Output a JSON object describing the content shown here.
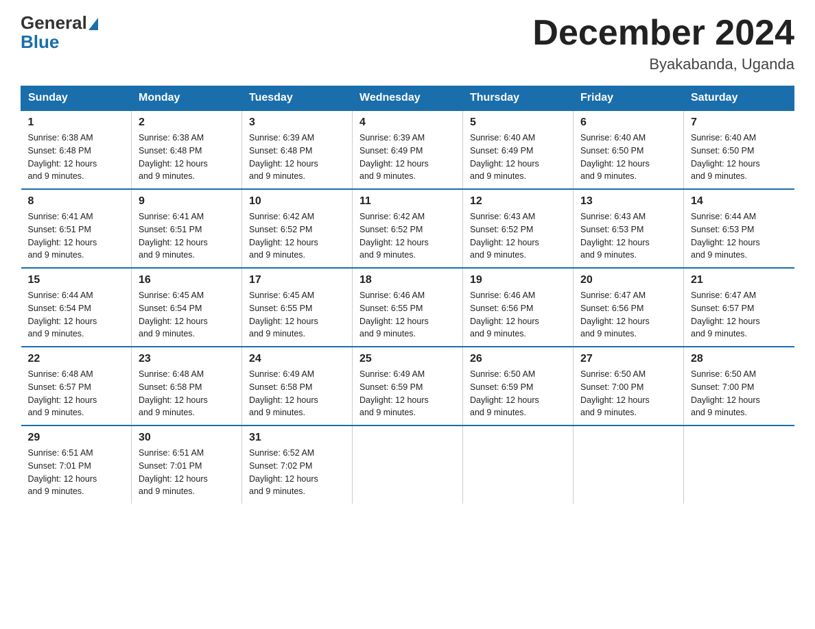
{
  "header": {
    "logo_general": "General",
    "logo_blue": "Blue",
    "month_title": "December 2024",
    "location": "Byakabanda, Uganda"
  },
  "days_of_week": [
    "Sunday",
    "Monday",
    "Tuesday",
    "Wednesday",
    "Thursday",
    "Friday",
    "Saturday"
  ],
  "weeks": [
    [
      {
        "day": "1",
        "sunrise": "6:38 AM",
        "sunset": "6:48 PM",
        "daylight": "12 hours and 9 minutes."
      },
      {
        "day": "2",
        "sunrise": "6:38 AM",
        "sunset": "6:48 PM",
        "daylight": "12 hours and 9 minutes."
      },
      {
        "day": "3",
        "sunrise": "6:39 AM",
        "sunset": "6:48 PM",
        "daylight": "12 hours and 9 minutes."
      },
      {
        "day": "4",
        "sunrise": "6:39 AM",
        "sunset": "6:49 PM",
        "daylight": "12 hours and 9 minutes."
      },
      {
        "day": "5",
        "sunrise": "6:40 AM",
        "sunset": "6:49 PM",
        "daylight": "12 hours and 9 minutes."
      },
      {
        "day": "6",
        "sunrise": "6:40 AM",
        "sunset": "6:50 PM",
        "daylight": "12 hours and 9 minutes."
      },
      {
        "day": "7",
        "sunrise": "6:40 AM",
        "sunset": "6:50 PM",
        "daylight": "12 hours and 9 minutes."
      }
    ],
    [
      {
        "day": "8",
        "sunrise": "6:41 AM",
        "sunset": "6:51 PM",
        "daylight": "12 hours and 9 minutes."
      },
      {
        "day": "9",
        "sunrise": "6:41 AM",
        "sunset": "6:51 PM",
        "daylight": "12 hours and 9 minutes."
      },
      {
        "day": "10",
        "sunrise": "6:42 AM",
        "sunset": "6:52 PM",
        "daylight": "12 hours and 9 minutes."
      },
      {
        "day": "11",
        "sunrise": "6:42 AM",
        "sunset": "6:52 PM",
        "daylight": "12 hours and 9 minutes."
      },
      {
        "day": "12",
        "sunrise": "6:43 AM",
        "sunset": "6:52 PM",
        "daylight": "12 hours and 9 minutes."
      },
      {
        "day": "13",
        "sunrise": "6:43 AM",
        "sunset": "6:53 PM",
        "daylight": "12 hours and 9 minutes."
      },
      {
        "day": "14",
        "sunrise": "6:44 AM",
        "sunset": "6:53 PM",
        "daylight": "12 hours and 9 minutes."
      }
    ],
    [
      {
        "day": "15",
        "sunrise": "6:44 AM",
        "sunset": "6:54 PM",
        "daylight": "12 hours and 9 minutes."
      },
      {
        "day": "16",
        "sunrise": "6:45 AM",
        "sunset": "6:54 PM",
        "daylight": "12 hours and 9 minutes."
      },
      {
        "day": "17",
        "sunrise": "6:45 AM",
        "sunset": "6:55 PM",
        "daylight": "12 hours and 9 minutes."
      },
      {
        "day": "18",
        "sunrise": "6:46 AM",
        "sunset": "6:55 PM",
        "daylight": "12 hours and 9 minutes."
      },
      {
        "day": "19",
        "sunrise": "6:46 AM",
        "sunset": "6:56 PM",
        "daylight": "12 hours and 9 minutes."
      },
      {
        "day": "20",
        "sunrise": "6:47 AM",
        "sunset": "6:56 PM",
        "daylight": "12 hours and 9 minutes."
      },
      {
        "day": "21",
        "sunrise": "6:47 AM",
        "sunset": "6:57 PM",
        "daylight": "12 hours and 9 minutes."
      }
    ],
    [
      {
        "day": "22",
        "sunrise": "6:48 AM",
        "sunset": "6:57 PM",
        "daylight": "12 hours and 9 minutes."
      },
      {
        "day": "23",
        "sunrise": "6:48 AM",
        "sunset": "6:58 PM",
        "daylight": "12 hours and 9 minutes."
      },
      {
        "day": "24",
        "sunrise": "6:49 AM",
        "sunset": "6:58 PM",
        "daylight": "12 hours and 9 minutes."
      },
      {
        "day": "25",
        "sunrise": "6:49 AM",
        "sunset": "6:59 PM",
        "daylight": "12 hours and 9 minutes."
      },
      {
        "day": "26",
        "sunrise": "6:50 AM",
        "sunset": "6:59 PM",
        "daylight": "12 hours and 9 minutes."
      },
      {
        "day": "27",
        "sunrise": "6:50 AM",
        "sunset": "7:00 PM",
        "daylight": "12 hours and 9 minutes."
      },
      {
        "day": "28",
        "sunrise": "6:50 AM",
        "sunset": "7:00 PM",
        "daylight": "12 hours and 9 minutes."
      }
    ],
    [
      {
        "day": "29",
        "sunrise": "6:51 AM",
        "sunset": "7:01 PM",
        "daylight": "12 hours and 9 minutes."
      },
      {
        "day": "30",
        "sunrise": "6:51 AM",
        "sunset": "7:01 PM",
        "daylight": "12 hours and 9 minutes."
      },
      {
        "day": "31",
        "sunrise": "6:52 AM",
        "sunset": "7:02 PM",
        "daylight": "12 hours and 9 minutes."
      },
      null,
      null,
      null,
      null
    ]
  ],
  "labels": {
    "sunrise": "Sunrise:",
    "sunset": "Sunset:",
    "daylight": "Daylight:"
  }
}
